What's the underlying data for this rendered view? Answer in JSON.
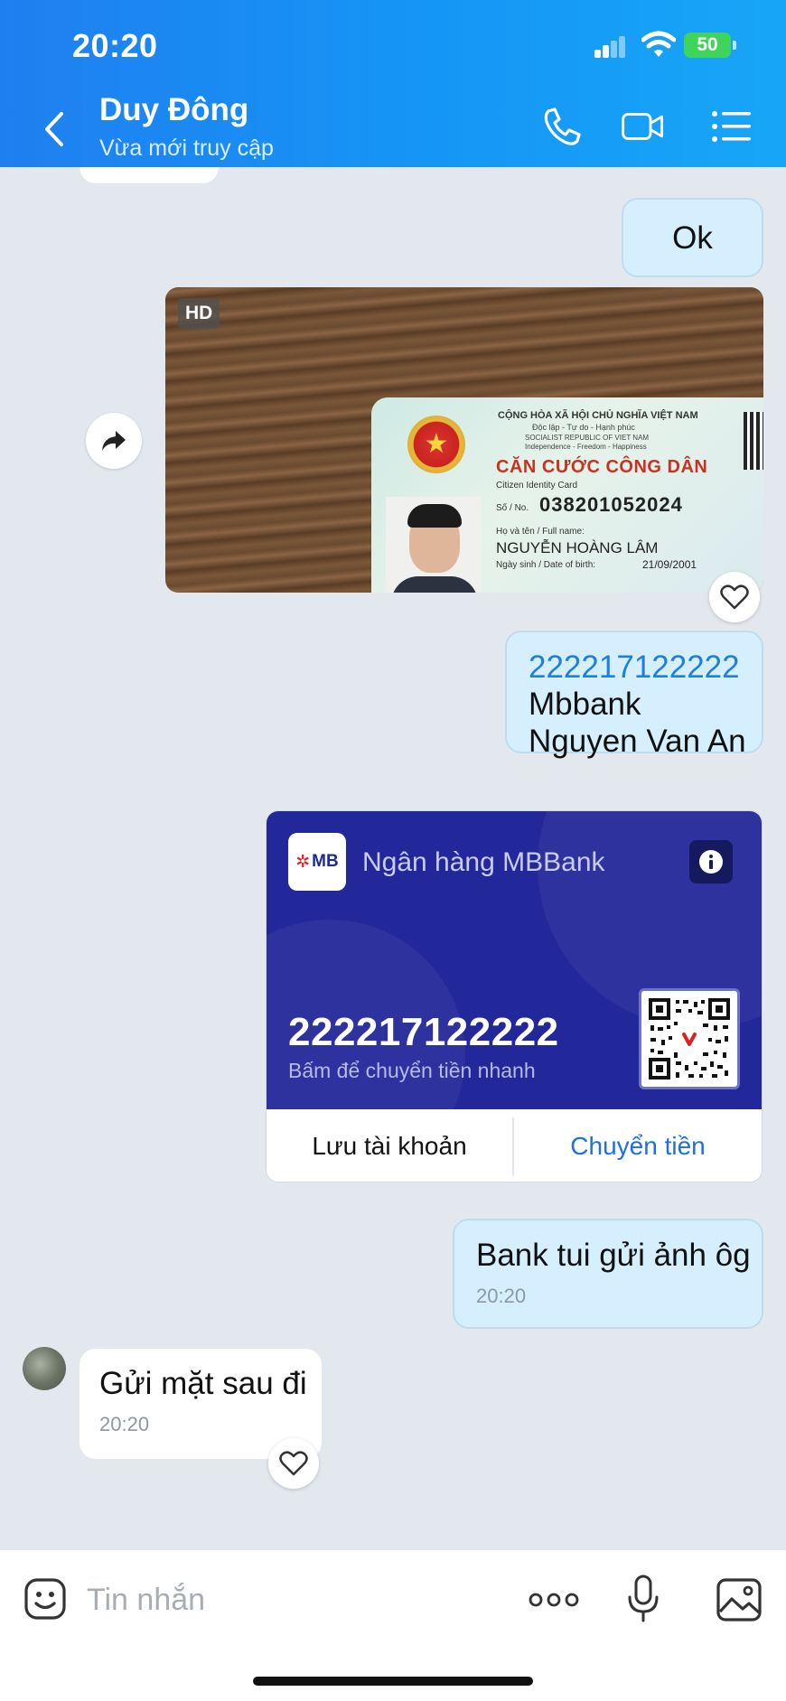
{
  "status_bar": {
    "time": "20:20",
    "battery": "50"
  },
  "header": {
    "name": "Duy Đông",
    "status": "Vừa mới truy cập"
  },
  "messages": {
    "ok_text": "Ok",
    "photo": {
      "badge": "HD",
      "card": {
        "line1": "CỘNG HÒA XÃ HỘI CHỦ NGHĨA VIỆT NAM",
        "line2": "Độc lập - Tự do - Hạnh phúc",
        "line3": "SOCIALIST REPUBLIC OF VIET NAM",
        "line4": "Independence - Freedom - Happiness",
        "title": "CĂN CƯỚC CÔNG DÂN",
        "subtitle": "Citizen Identity Card",
        "no_label": "Số / No.",
        "number": "038201052024",
        "name_label": "Họ và tên / Full name:",
        "name": "NGUYỄN HOÀNG LÂM",
        "dob_label": "Ngày sinh / Date of birth:",
        "dob": "21/09/2001"
      }
    },
    "account_msg": {
      "number": "222217122222",
      "bank": "Mbbank",
      "holder": "Nguyen Van An"
    },
    "bank_card": {
      "logo": "MB",
      "bank_name": "Ngân hàng MBBank",
      "account_no": "222217122222",
      "hint": "Bấm để chuyển tiền nhanh",
      "save_label": "Lưu tài khoản",
      "transfer_label": "Chuyển tiền"
    },
    "out_msg": {
      "text": "Bank tui gửi ảnh ôg",
      "time": "20:20"
    },
    "in_msg": {
      "text": "Gửi mặt sau đi",
      "time": "20:20"
    }
  },
  "input": {
    "placeholder": "Tin nhắn"
  },
  "colors": {
    "header": "#1f8af2",
    "bank_card": "#22279a",
    "out_bubble": "#d5efff",
    "link": "#1f7fe0"
  }
}
